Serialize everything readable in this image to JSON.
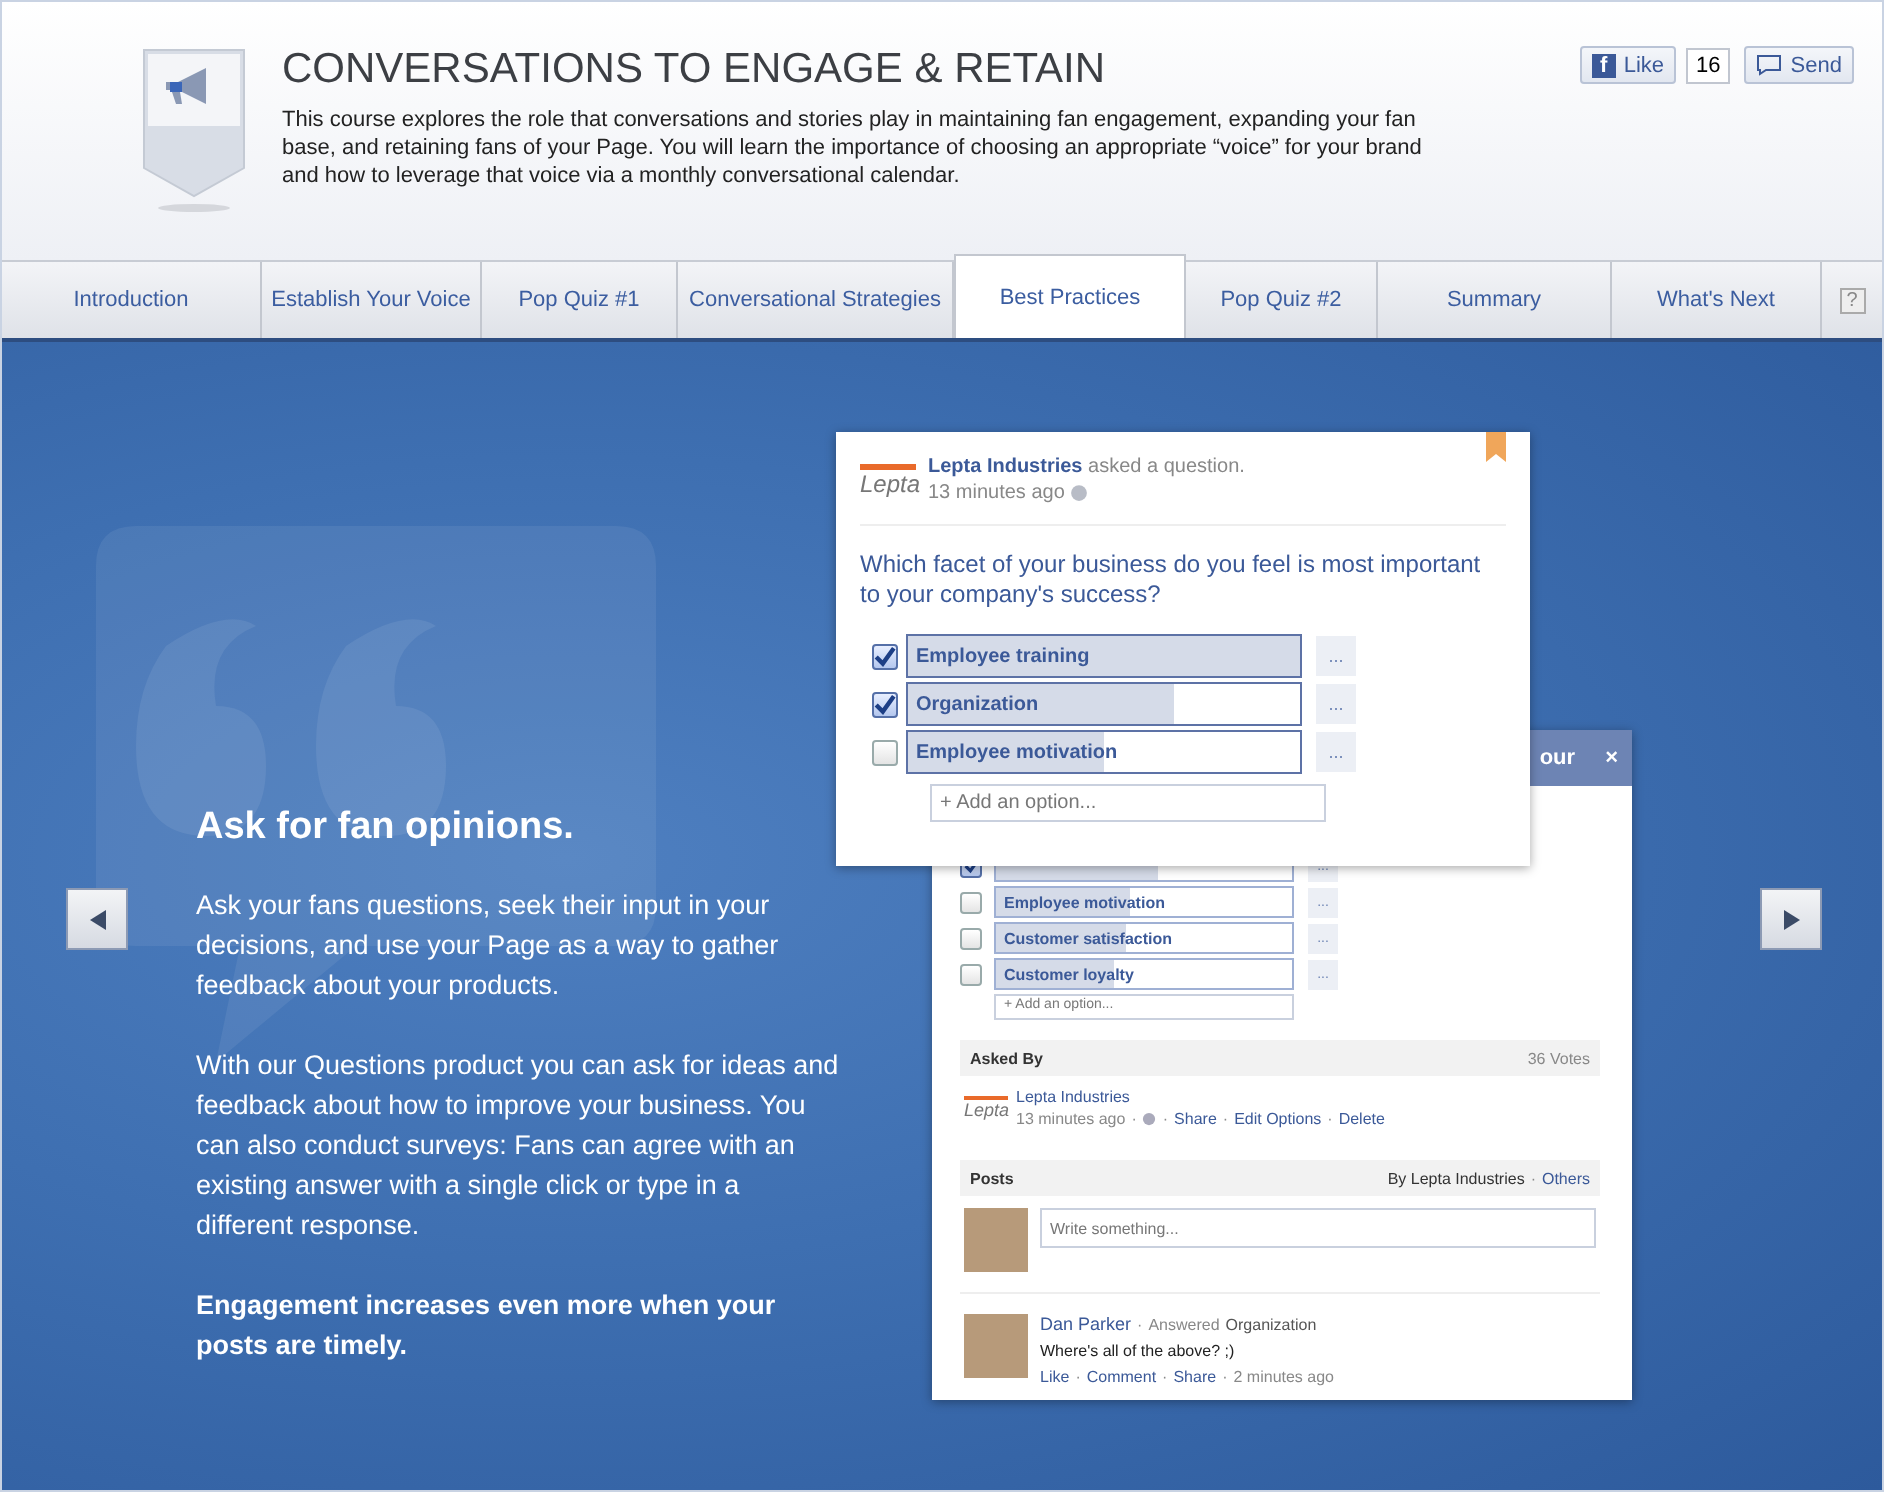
{
  "header": {
    "title": "CONVERSATIONS TO ENGAGE & RETAIN",
    "description": "This course explores the role that conversations and stories play in maintaining fan engagement, expanding your fan base, and retaining fans of your Page. You will learn the importance of choosing an appropriate “voice” for your brand and how to leverage that voice via a monthly conversational calendar.",
    "like_button": "Like",
    "like_logo": "f",
    "like_count": "16",
    "send_button": "Send"
  },
  "tabs": [
    {
      "label": "Introduction",
      "selected": false
    },
    {
      "label": "Establish Your Voice",
      "selected": false
    },
    {
      "label": "Pop Quiz #1",
      "selected": false
    },
    {
      "label": "Conversational Strategies",
      "selected": false
    },
    {
      "label": "Best Practices",
      "selected": true
    },
    {
      "label": "Pop Quiz #2",
      "selected": false
    },
    {
      "label": "Summary",
      "selected": false
    },
    {
      "label": "What's Next",
      "selected": false
    }
  ],
  "help_button": "?",
  "slide": {
    "heading": "Ask for fan opinions.",
    "paragraphs": [
      {
        "kind": "body",
        "text": "Ask your fans questions, seek their input in your decisions, and use your Page as a way to gather feedback about your products."
      },
      {
        "kind": "body",
        "text": "With our Questions product you can ask for ideas and feedback about how to improve your business. You can also conduct surveys: Fans can agree with an existing answer with a single click or type in a different response."
      },
      {
        "kind": "emphasis",
        "text": "Engagement increases even more when your posts are timely."
      }
    ]
  },
  "question_card": {
    "logo_text": "Lepta",
    "author": "Lepta Industries",
    "action": "asked a question.",
    "time": "13 minutes ago",
    "question": "Which facet of your business do you feel is most important to your company's success?",
    "more_button": "...",
    "options": [
      {
        "label": "Employee training",
        "checked": true,
        "level": 1
      },
      {
        "label": "Organization",
        "checked": true,
        "level": 0.68
      },
      {
        "label": "Employee motivation",
        "checked": false,
        "level": 0.5
      }
    ],
    "add_option": "+ Add an option..."
  },
  "results_card": {
    "header_title": "our",
    "close": "×",
    "more_button": "...",
    "options": [
      {
        "checked": true,
        "level": 0.55
      },
      {
        "label": "Employee motivation",
        "checked": false,
        "level": 0.45
      },
      {
        "label": "Customer satisfaction",
        "checked": false,
        "level": 0.44
      },
      {
        "label": "Customer loyalty",
        "checked": false,
        "level": 0.4
      }
    ],
    "add_option": "+ Add an option...",
    "asked_by": {
      "label": "Asked By",
      "votes": "36 Votes",
      "logo_text": "Lepta",
      "author": "Lepta Industries",
      "time": "13 minutes ago",
      "separator": "·",
      "actions": [
        "Share",
        "Edit Options",
        "Delete"
      ]
    },
    "posts": {
      "label": "Posts",
      "filter": "By Lepta Industries",
      "separator": "·",
      "filter_link": "Others",
      "composer_placeholder": "Write something...",
      "comment": {
        "author": "Dan Parker",
        "action": "Answered",
        "answer": "Organization",
        "text": "Where's all of the above? ;)",
        "actions": [
          "Like",
          "Comment",
          "Share"
        ],
        "time": "2 minutes ago"
      }
    }
  }
}
